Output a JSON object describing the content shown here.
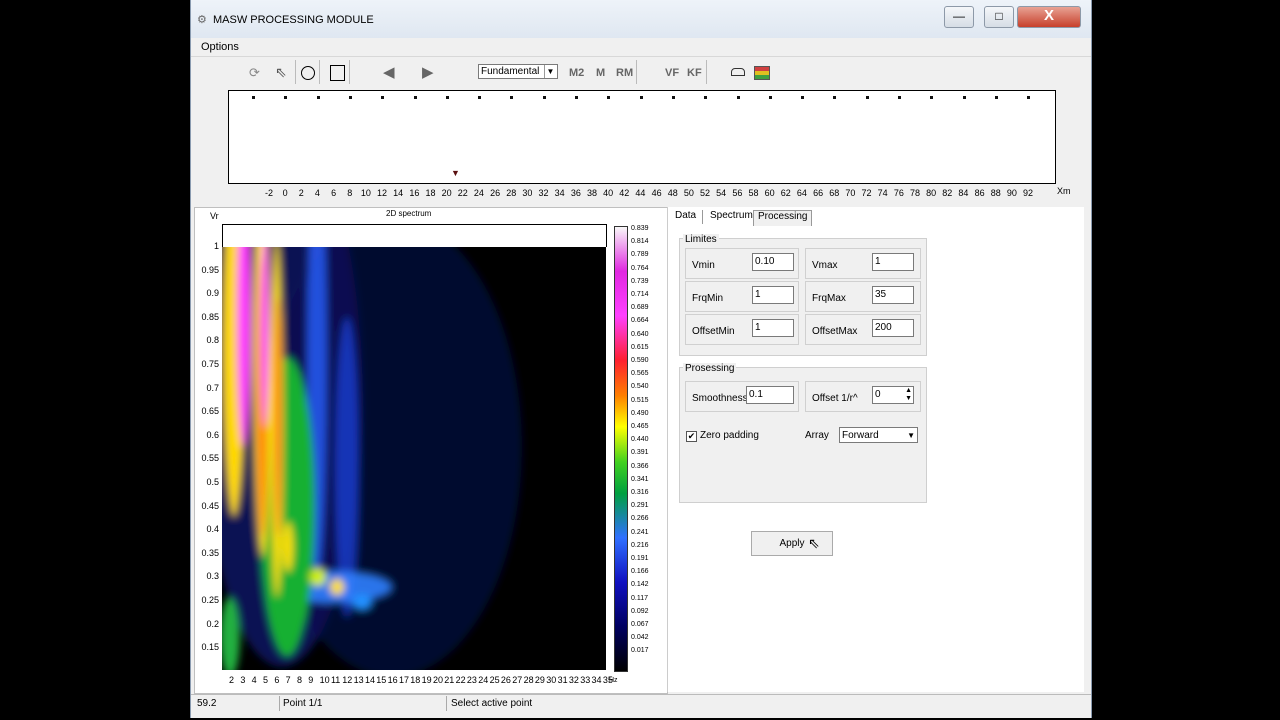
{
  "window": {
    "title": "MASW PROCESSING MODULE",
    "min": "—",
    "max": "□",
    "close": "X"
  },
  "menu": {
    "options": "Options"
  },
  "toolbar": {
    "mode_select": "Fundamental",
    "buttons": [
      "M2",
      "M",
      "RM",
      "VF",
      "KF"
    ]
  },
  "offset_axis": {
    "ticks": [
      "-2",
      "0",
      "2",
      "4",
      "6",
      "8",
      "10",
      "12",
      "14",
      "16",
      "18",
      "20",
      "22",
      "24",
      "26",
      "28",
      "30",
      "32",
      "34",
      "36",
      "38",
      "40",
      "42",
      "44",
      "46",
      "48",
      "50",
      "52",
      "54",
      "56",
      "58",
      "60",
      "62",
      "64",
      "66",
      "68",
      "70",
      "72",
      "74",
      "76",
      "78",
      "80",
      "82",
      "84",
      "86",
      "88",
      "90",
      "92"
    ],
    "unit": "Xm"
  },
  "spectrum": {
    "title": "2D spectrum",
    "y_label": "Vr",
    "x_unit": "Hz",
    "y_ticks": [
      "1",
      "0.95",
      "0.9",
      "0.85",
      "0.8",
      "0.75",
      "0.7",
      "0.65",
      "0.6",
      "0.55",
      "0.5",
      "0.45",
      "0.4",
      "0.35",
      "0.3",
      "0.25",
      "0.2",
      "0.15"
    ],
    "x_ticks": [
      "2",
      "3",
      "4",
      "5",
      "6",
      "7",
      "8",
      "9",
      "10",
      "11",
      "12",
      "13",
      "14",
      "15",
      "16",
      "17",
      "18",
      "19",
      "20",
      "21",
      "22",
      "23",
      "24",
      "25",
      "26",
      "27",
      "28",
      "29",
      "30",
      "31",
      "32",
      "33",
      "34",
      "35"
    ],
    "colorbar": [
      "0.839",
      "0.814",
      "0.789",
      "0.764",
      "0.739",
      "0.714",
      "0.689",
      "0.664",
      "0.640",
      "0.615",
      "0.590",
      "0.565",
      "0.540",
      "0.515",
      "0.490",
      "0.465",
      "0.440",
      "0.391",
      "0.366",
      "0.341",
      "0.316",
      "0.291",
      "0.266",
      "0.241",
      "0.216",
      "0.191",
      "0.166",
      "0.142",
      "0.117",
      "0.092",
      "0.067",
      "0.042",
      "0.017"
    ]
  },
  "tabs": [
    "Data",
    "Spectrum",
    "Processing"
  ],
  "limites": {
    "title": "Limites",
    "vmin_label": "Vmin",
    "vmin": "0.10",
    "vmax_label": "Vmax",
    "vmax": "1",
    "frqmin_label": "FrqMin",
    "frqmin": "1",
    "frqmax_label": "FrqMax",
    "frqmax": "35",
    "offsetmin_label": "OffsetMin",
    "offsetmin": "1",
    "offsetmax_label": "OffsetMax",
    "offsetmax": "200"
  },
  "processing": {
    "title": "Prosessing",
    "smoothness_label": "Smoothness",
    "smoothness": "0.1",
    "offset_label": "Offset 1/r^",
    "offset": "0",
    "zero_padding_label": "Zero padding",
    "zero_padding_checked": "✔",
    "array_label": "Array",
    "array": "Forward"
  },
  "apply_label": "Apply",
  "status": {
    "value": "59.2",
    "point": "Point 1/1",
    "hint": "Select active point"
  }
}
